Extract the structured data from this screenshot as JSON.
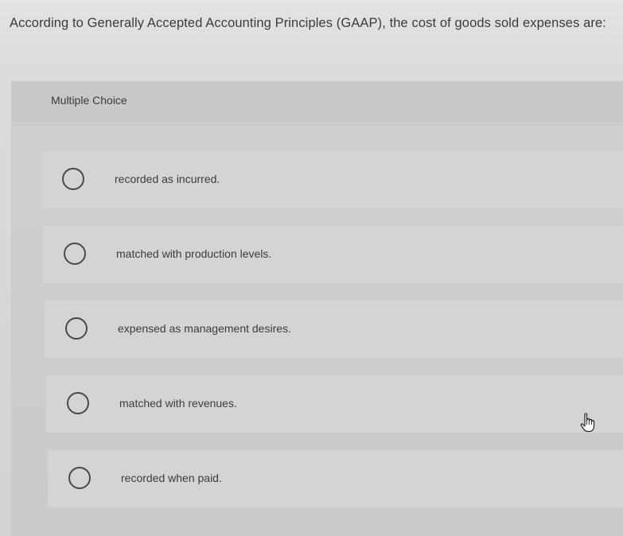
{
  "question": {
    "text": "According to Generally Accepted Accounting Principles (GAAP), the cost of goods sold expenses are:"
  },
  "multiple_choice": {
    "label": "Multiple Choice",
    "options": [
      {
        "label": "recorded as incurred.",
        "selected": false
      },
      {
        "label": "matched with production levels.",
        "selected": false
      },
      {
        "label": "expensed as management desires.",
        "selected": false
      },
      {
        "label": "matched with revenues.",
        "selected": false
      },
      {
        "label": "recorded when paid.",
        "selected": false
      }
    ]
  },
  "icons": {
    "radio": "radio-unselected-icon",
    "cursor": "hand-pointer-icon"
  }
}
